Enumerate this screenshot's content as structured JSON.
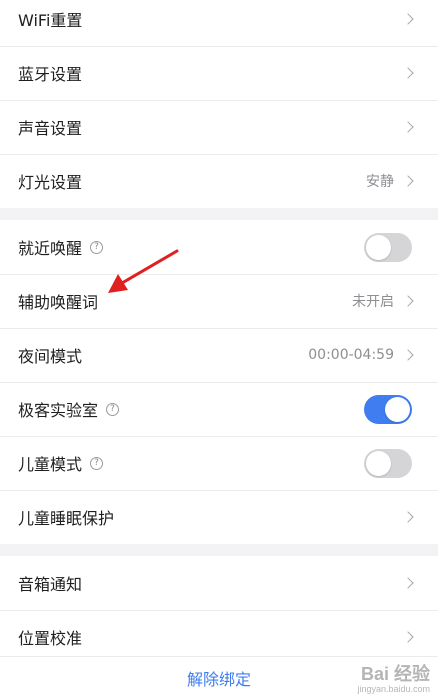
{
  "section1": [
    {
      "label": "WiFi重置"
    },
    {
      "label": "蓝牙设置"
    },
    {
      "label": "声音设置"
    },
    {
      "label": "灯光设置",
      "value": "安静"
    }
  ],
  "section2": {
    "nearby_wake": {
      "label": "就近唤醒",
      "help": "?",
      "toggle_on": false
    },
    "aux_wake_word": {
      "label": "辅助唤醒词",
      "value": "未开启"
    },
    "night_mode": {
      "label": "夜间模式",
      "value": "00:00-04:59"
    },
    "geek_lab": {
      "label": "极客实验室",
      "help": "?",
      "toggle_on": true
    },
    "kids_mode": {
      "label": "儿童模式",
      "help": "?",
      "toggle_on": false
    },
    "kids_sleep": {
      "label": "儿童睡眠保护"
    }
  },
  "section3": [
    {
      "label": "音箱通知"
    },
    {
      "label": "位置校准"
    }
  ],
  "footer": {
    "unbind_label": "解除绑定"
  },
  "watermark": {
    "brand": "Bai 经验",
    "site": "jingyan.baidu.com"
  },
  "colors": {
    "accent": "#3f7df0",
    "annotation_arrow": "#e02020",
    "toggle_off": "#d5d5d7"
  }
}
